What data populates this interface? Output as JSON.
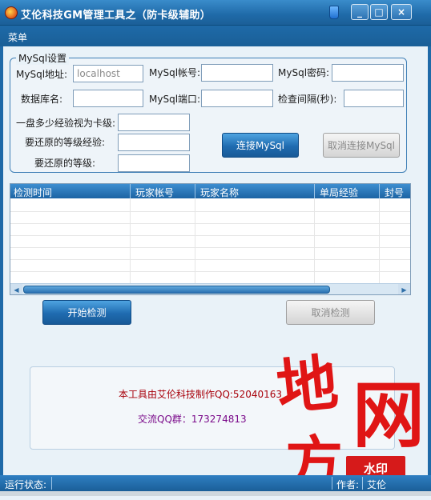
{
  "window": {
    "title": "艾伦科技GM管理工具之（防卡级辅助）",
    "buttons": [
      "_",
      "□",
      "×"
    ]
  },
  "menu": {
    "label": "菜单"
  },
  "mysql_group": {
    "title": "MySql设置",
    "host_label": "MySql地址:",
    "host_value": "localhost",
    "account_label": "MySql帐号:",
    "password_label": "MySql密码:",
    "dbname_label": "数据库名:",
    "port_label": "MySql端口:",
    "interval_label": "检查间隔(秒):",
    "exp_threshold_label": "一盘多少经验视为卡级:",
    "restore_exp_label": "要还原的等级经验:",
    "restore_level_label": "要还原的等级:",
    "connect_button": "连接MySql",
    "disconnect_button": "取消连接MySql"
  },
  "table": {
    "columns": [
      "检测时间",
      "玩家帐号",
      "玩家名称",
      "单局经验",
      "封号"
    ],
    "rows": []
  },
  "actions": {
    "start_button": "开始检测",
    "cancel_button": "取消检测"
  },
  "info": {
    "line1": "本工具由艾伦科技制作QQ:52040163",
    "line2": "交流QQ群：173274813"
  },
  "watermark": {
    "chars": [
      "地",
      "网",
      "方"
    ],
    "stamp": "水印"
  },
  "statusbar": {
    "status_label": "运行状态:",
    "author_label": "作者:",
    "author_value": "艾伦"
  },
  "colors": {
    "title_bar": "#1f6aa8",
    "button_blue": "#1f6bb0",
    "info_red": "#a8000a",
    "info_purple": "#7a0a8a",
    "watermark_red": "#e01515"
  }
}
